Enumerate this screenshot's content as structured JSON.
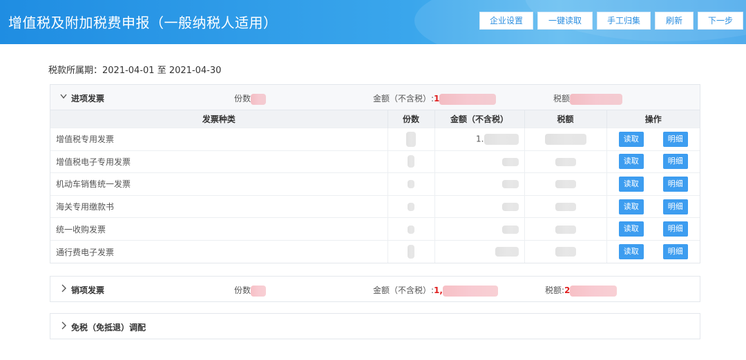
{
  "header": {
    "title": "增值税及附加税费申报（一般纳税人适用）",
    "buttons": [
      "企业设置",
      "一键读取",
      "手工归集",
      "刷新",
      "下一步"
    ]
  },
  "period": {
    "label": "税款所属期：",
    "range": "2021-04-01 至 2021-04-30"
  },
  "input_invoices": {
    "title": "进项发票",
    "count_label": "份数",
    "amount_label": "金额（不含税）:",
    "amount_prefix": "1",
    "tax_label": "税额",
    "columns": [
      "发票种类",
      "份数",
      "金额（不含税）",
      "税额",
      "操作"
    ],
    "rows": [
      {
        "name": "增值税专用发票",
        "amount_prefix": "1."
      },
      {
        "name": "增值税电子专用发票",
        "amount_prefix": ""
      },
      {
        "name": "机动车销售统一发票",
        "amount_prefix": ""
      },
      {
        "name": "海关专用缴款书",
        "amount_prefix": ""
      },
      {
        "name": "统一收购发票",
        "amount_prefix": ""
      },
      {
        "name": "通行费电子发票",
        "amount_prefix": ""
      }
    ],
    "read_label": "读取",
    "detail_label": "明细"
  },
  "output_invoices": {
    "title": "销项发票",
    "count_label": "份数",
    "amount_label": "金额（不含税）:",
    "amount_prefix": "1,",
    "tax_label": "税额:",
    "tax_prefix": "2"
  },
  "exempt": {
    "title": "免税（免抵退）调配"
  },
  "colors": {
    "header_blue": "#2b97e6",
    "action_blue": "#3d9df0",
    "amount_red": "#e02020"
  }
}
